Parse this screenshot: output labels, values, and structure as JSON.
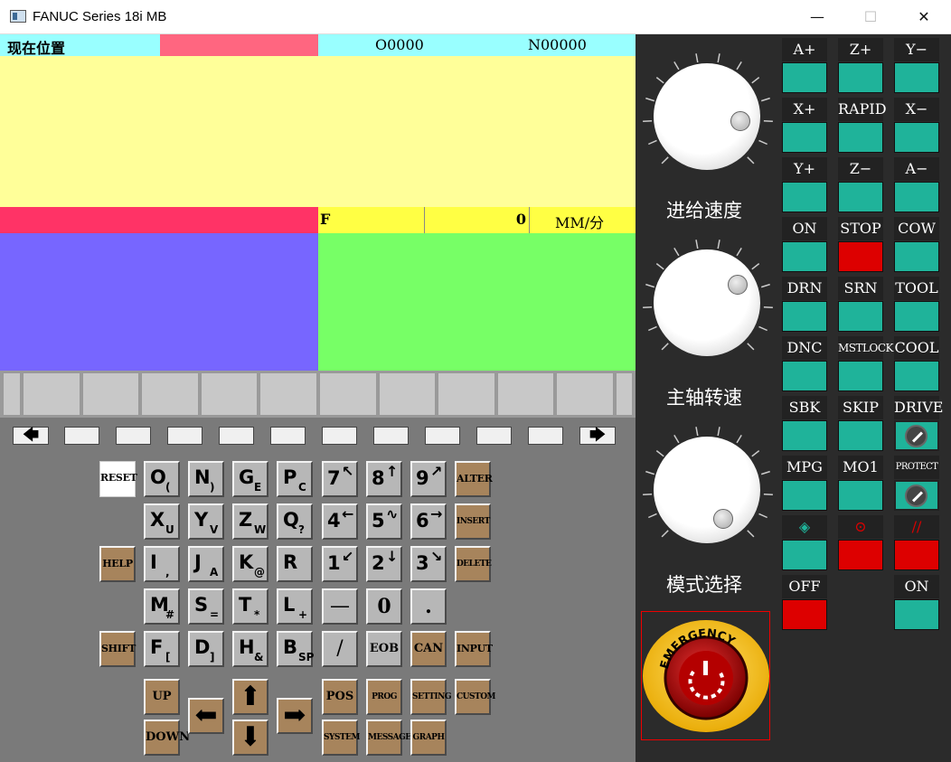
{
  "window": {
    "title": "FANUC Series 18i MB",
    "minimize": "—",
    "maximize": "☐",
    "close": "✕"
  },
  "screen": {
    "header_label": "现在位置",
    "program_no": "O0000",
    "sequence_no": "N00000",
    "feed_label": "F",
    "feed_value": "0",
    "feed_unit": "MM/分",
    "colors": {
      "header_cyan": "#99ffff",
      "header_pink": "#ff6680",
      "main_yellow": "#ffff99",
      "status_red": "#ff3366",
      "feed_yellow": "#ffff44",
      "panel_blue": "#7766ff",
      "panel_green": "#77ff66"
    }
  },
  "softkey_nav": {
    "left": "🡄",
    "right": "🡆"
  },
  "keys": {
    "reset": "RESET",
    "help": "HELP",
    "shift": "SHIFT",
    "alter": "ALTER",
    "insert": "INSERT",
    "delete": "DELETE",
    "can": "CAN",
    "input": "INPUT",
    "eob": "EOB",
    "up": "UP",
    "down": "DOWN",
    "pos": "POS",
    "prog": "PROG",
    "setting": "SETTING",
    "custom": "CUSTOM",
    "system": "SYSTEM",
    "message": "MESSAGE",
    "graph": "GRAPH",
    "minus": "—",
    "zero": "0",
    "dot": ".",
    "slash": "/",
    "letters": [
      {
        "m": "O",
        "s": "("
      },
      {
        "m": "N",
        "s": ")"
      },
      {
        "m": "G",
        "s": "E"
      },
      {
        "m": "P",
        "s": "C"
      },
      {
        "m": "X",
        "s": "U"
      },
      {
        "m": "Y",
        "s": "V"
      },
      {
        "m": "Z",
        "s": "W"
      },
      {
        "m": "Q",
        "s": "?"
      },
      {
        "m": "I",
        "s": ","
      },
      {
        "m": "J",
        "s": "A"
      },
      {
        "m": "K",
        "s": "@"
      },
      {
        "m": "R",
        "s": ""
      },
      {
        "m": "M",
        "s": "#"
      },
      {
        "m": "S",
        "s": "="
      },
      {
        "m": "T",
        "s": "*"
      },
      {
        "m": "L",
        "s": "+"
      },
      {
        "m": "F",
        "s": "["
      },
      {
        "m": "D",
        "s": "]"
      },
      {
        "m": "H",
        "s": "&"
      },
      {
        "m": "B",
        "s": "SP"
      }
    ],
    "digits": [
      {
        "m": "7",
        "s": "↖"
      },
      {
        "m": "8",
        "s": "↑"
      },
      {
        "m": "9",
        "s": "↗"
      },
      {
        "m": "4",
        "s": "←"
      },
      {
        "m": "5",
        "s": "∿"
      },
      {
        "m": "6",
        "s": "→"
      },
      {
        "m": "1",
        "s": "↙"
      },
      {
        "m": "2",
        "s": "↓"
      },
      {
        "m": "3",
        "s": "↘"
      }
    ],
    "arrow_up": "⬆",
    "arrow_down": "⬇",
    "arrow_left": "⬅",
    "arrow_right": "➡"
  },
  "knobs": [
    "进给速度",
    "主轴转速",
    "模式选择"
  ],
  "panel": {
    "labels": [
      "A+",
      "Z+",
      "Y−",
      "X+",
      "RAPID",
      "X−",
      "Y+",
      "Z−",
      "A−",
      "ON",
      "STOP",
      "COW",
      "DRN",
      "SRN",
      "TOOL",
      "DNC",
      "MSTLOCK",
      "COOL",
      "SBK",
      "SKIP",
      "DRIVE",
      "MPG",
      "MO1",
      "PROTECT",
      "◈",
      "⊙",
      "//",
      "OFF",
      "",
      "ON"
    ],
    "emergency_text": "EMERGENCY"
  }
}
